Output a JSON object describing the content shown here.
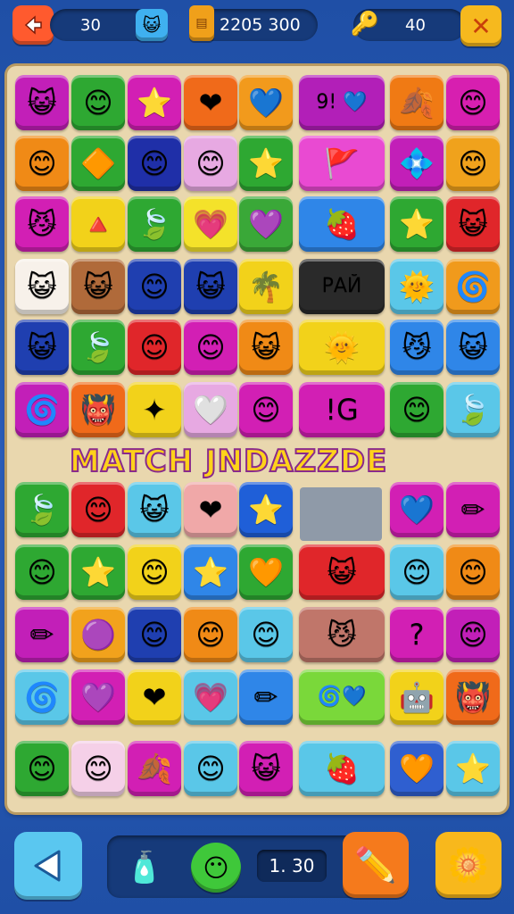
{
  "hud": {
    "back_icon": "arrow-left-icon",
    "moves_value": "30",
    "bonus_icon": "cat-badge-icon",
    "jar_icon": "honey-jar-icon",
    "score_value": "2205 300",
    "key_icon": "key-icon",
    "coins_value": "40",
    "close_icon": "close-icon"
  },
  "banner_text": "MATCH JNDAZZDE",
  "board": {
    "tiles": [
      {
        "color": "#c21fb8",
        "glyph": "😺"
      },
      {
        "color": "#2ea832",
        "glyph": "😊"
      },
      {
        "color": "#d21fb4",
        "glyph": "⭐"
      },
      {
        "color": "#f06a1a",
        "glyph": "❤"
      },
      {
        "color": "#f29a1c",
        "glyph": "💙"
      },
      {
        "color": "#b21fb8",
        "glyph": "9! 💙"
      },
      {
        "color": "#f07a14",
        "glyph": "🍂"
      },
      {
        "color": "#d71fb0",
        "glyph": "😊"
      },
      {
        "color": "#f08a16",
        "glyph": "😊"
      },
      {
        "color": "#2ea832",
        "glyph": "🔶"
      },
      {
        "color": "#1f2fa8",
        "glyph": "😊"
      },
      {
        "color": "#e7a9e2",
        "glyph": "😊"
      },
      {
        "color": "#2ea832",
        "glyph": "⭐"
      },
      {
        "color": "#e94ad2",
        "glyph": "🚩"
      },
      {
        "color": "#c21fb8",
        "glyph": "💠"
      },
      {
        "color": "#f0a21c",
        "glyph": "😊"
      },
      {
        "color": "#d21fb4",
        "glyph": "😼"
      },
      {
        "color": "#f2d21a",
        "glyph": "🔺"
      },
      {
        "color": "#2ea832",
        "glyph": "🍃"
      },
      {
        "color": "#f4e22a",
        "glyph": "💗"
      },
      {
        "color": "#3aa838",
        "glyph": "💜"
      },
      {
        "color": "#2f86e8",
        "glyph": "🍓"
      },
      {
        "color": "#2ea832",
        "glyph": "⭐"
      },
      {
        "color": "#e0262a",
        "glyph": "😺"
      },
      {
        "color": "#f7f1ea",
        "glyph": "😺"
      },
      {
        "color": "#b06a3a",
        "glyph": "😺"
      },
      {
        "color": "#1f3fb0",
        "glyph": "😊"
      },
      {
        "color": "#1f3fb0",
        "glyph": "😺"
      },
      {
        "color": "#f2d21a",
        "glyph": "🌴"
      },
      {
        "color": "#2a2a2a",
        "glyph": "РАЙ"
      },
      {
        "color": "#5ac7e8",
        "glyph": "🌞"
      },
      {
        "color": "#f09a1c",
        "glyph": "🌀"
      },
      {
        "color": "#1f3fb0",
        "glyph": "😺"
      },
      {
        "color": "#2ea832",
        "glyph": "🍃"
      },
      {
        "color": "#e0262a",
        "glyph": "😊"
      },
      {
        "color": "#d21fb4",
        "glyph": "😊"
      },
      {
        "color": "#f08a16",
        "glyph": "😺"
      },
      {
        "color": "#f2d21a",
        "glyph": "🌞"
      },
      {
        "color": "#2f86e8",
        "glyph": "😼"
      },
      {
        "color": "#2f86e8",
        "glyph": "😺"
      },
      {
        "color": "#c21fb8",
        "glyph": "🌀"
      },
      {
        "color": "#f06a1a",
        "glyph": "👹"
      },
      {
        "color": "#f2d21a",
        "glyph": "✦"
      },
      {
        "color": "#e7a9e2",
        "glyph": "🤍"
      },
      {
        "color": "#d21fb4",
        "glyph": "😊"
      },
      {
        "color": "#d21fb4",
        "glyph": "!G"
      },
      {
        "color": "#2ea832",
        "glyph": "😊"
      },
      {
        "color": "#5ac7e8",
        "glyph": "🍃"
      },
      {
        "color": "#2ea832",
        "glyph": "🍃"
      },
      {
        "color": "#e0262a",
        "glyph": "😊"
      },
      {
        "color": "#5ac7e8",
        "glyph": "😺"
      },
      {
        "color": "#f0a8a8",
        "glyph": "❤"
      },
      {
        "color": "#1f5fd8",
        "glyph": "⭐"
      },
      {
        "color": "#d21fb4",
        "glyph": "💙"
      },
      {
        "color": "#d21fb4",
        "glyph": "✏"
      },
      {
        "color": "#2ea832",
        "glyph": "😊"
      },
      {
        "color": "#2ea832",
        "glyph": "⭐"
      },
      {
        "color": "#f2d21a",
        "glyph": "😊"
      },
      {
        "color": "#2f86e8",
        "glyph": "⭐"
      },
      {
        "color": "#2ea832",
        "glyph": "🧡"
      },
      {
        "color": "#e0262a",
        "glyph": "😺"
      },
      {
        "color": "#5ac7e8",
        "glyph": "😊"
      },
      {
        "color": "#f08a16",
        "glyph": "😊"
      },
      {
        "color": "#c21fb8",
        "glyph": "✏"
      },
      {
        "color": "#f2a21c",
        "glyph": "🟣"
      },
      {
        "color": "#1f3fb0",
        "glyph": "😊"
      },
      {
        "color": "#f08a16",
        "glyph": "😊"
      },
      {
        "color": "#5ac7e8",
        "glyph": "😊"
      },
      {
        "color": "#c0766a",
        "glyph": "😼"
      },
      {
        "color": "#d21fb4",
        "glyph": "?"
      },
      {
        "color": "#c21fb8",
        "glyph": "😊"
      },
      {
        "color": "#5ac7e8",
        "glyph": "🌀"
      },
      {
        "color": "#d21fb4",
        "glyph": "💜"
      },
      {
        "color": "#f2d21a",
        "glyph": "❤"
      },
      {
        "color": "#5ac7e8",
        "glyph": "💗"
      },
      {
        "color": "#2f86e8",
        "glyph": "✏"
      },
      {
        "color": "#7ad83a",
        "glyph": "🌀💙"
      },
      {
        "color": "#f2d21a",
        "glyph": "🤖"
      },
      {
        "color": "#f06a1a",
        "glyph": "👹"
      },
      {
        "color": "#2ea832",
        "glyph": "😊"
      },
      {
        "color": "#f5d0e8",
        "glyph": "😊"
      },
      {
        "color": "#d21fb4",
        "glyph": "🍂"
      },
      {
        "color": "#5ac7e8",
        "glyph": "😊"
      },
      {
        "color": "#d21fb4",
        "glyph": "😺"
      },
      {
        "color": "#5ac7e8",
        "glyph": "🍓"
      },
      {
        "color": "#2f5fd0",
        "glyph": "🧡"
      },
      {
        "color": "#5ac7e8",
        "glyph": "⭐"
      }
    ]
  },
  "footer": {
    "play_icon": "triangle-left-icon",
    "booster1_icon": "bottle-icon",
    "booster2_icon": "chat-face-icon",
    "counter_value": "1. 30",
    "pencil_icon": "pencil-icon",
    "settings_icon": "flower-gear-icon"
  }
}
